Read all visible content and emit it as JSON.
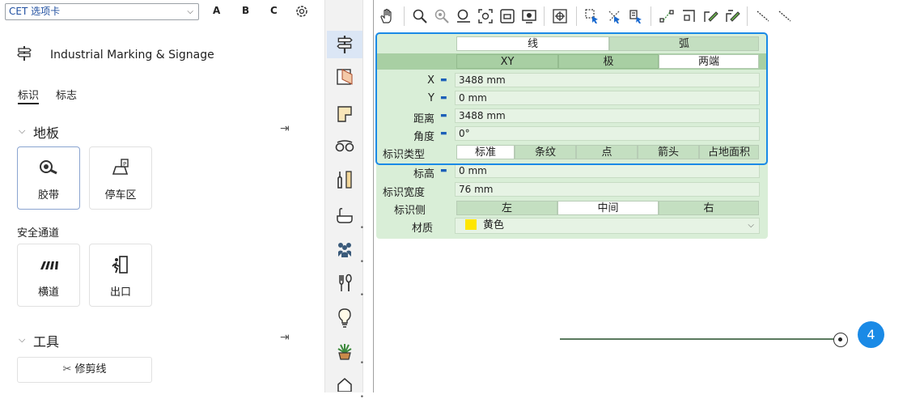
{
  "left_panel": {
    "tab_selector": {
      "value": "CET 选项卡"
    },
    "letter_buttons": [
      "A",
      "B",
      "C"
    ],
    "header_title": "Industrial Marking & Signage",
    "tabs": [
      {
        "label": "标识"
      },
      {
        "label": "标志"
      }
    ],
    "section_floor": {
      "title": "地板"
    },
    "floor_items": [
      {
        "label": "胶带"
      },
      {
        "label": "停车区"
      }
    ],
    "subsection_aisle": {
      "title": "安全通道"
    },
    "aisle_items": [
      {
        "label": "横道"
      },
      {
        "label": "出口"
      }
    ],
    "section_tools": {
      "title": "工具"
    },
    "tool_button": {
      "label": "修剪线"
    }
  },
  "collapse_glyph": "<",
  "props": {
    "mode_tabs": [
      {
        "label": "线"
      },
      {
        "label": "弧"
      }
    ],
    "coord_tabs": [
      {
        "label": "XY"
      },
      {
        "label": "极"
      },
      {
        "label": "两端"
      }
    ],
    "rows": [
      {
        "label": "X",
        "value": "3488 mm"
      },
      {
        "label": "Y",
        "value": "0 mm"
      },
      {
        "label": "距离",
        "value": "3488 mm"
      },
      {
        "label": "角度",
        "value": "0°"
      }
    ],
    "type_label": "标识类型",
    "type_options": [
      {
        "label": "标准"
      },
      {
        "label": "条纹"
      },
      {
        "label": "点"
      },
      {
        "label": "箭头"
      },
      {
        "label": "占地面积"
      }
    ],
    "height_label": "标高",
    "height_value": "0 mm",
    "width_label": "标识宽度",
    "width_value": "76 mm",
    "side_label": "标识侧",
    "side_options": [
      {
        "label": "左"
      },
      {
        "label": "中间"
      },
      {
        "label": "右"
      }
    ],
    "material_label": "材质",
    "material_value": "黄色",
    "material_color": "#ffe600"
  },
  "badge_number": "4",
  "colors": {
    "accent": "#1a8ae6",
    "panel_green": "#d9eed7"
  }
}
